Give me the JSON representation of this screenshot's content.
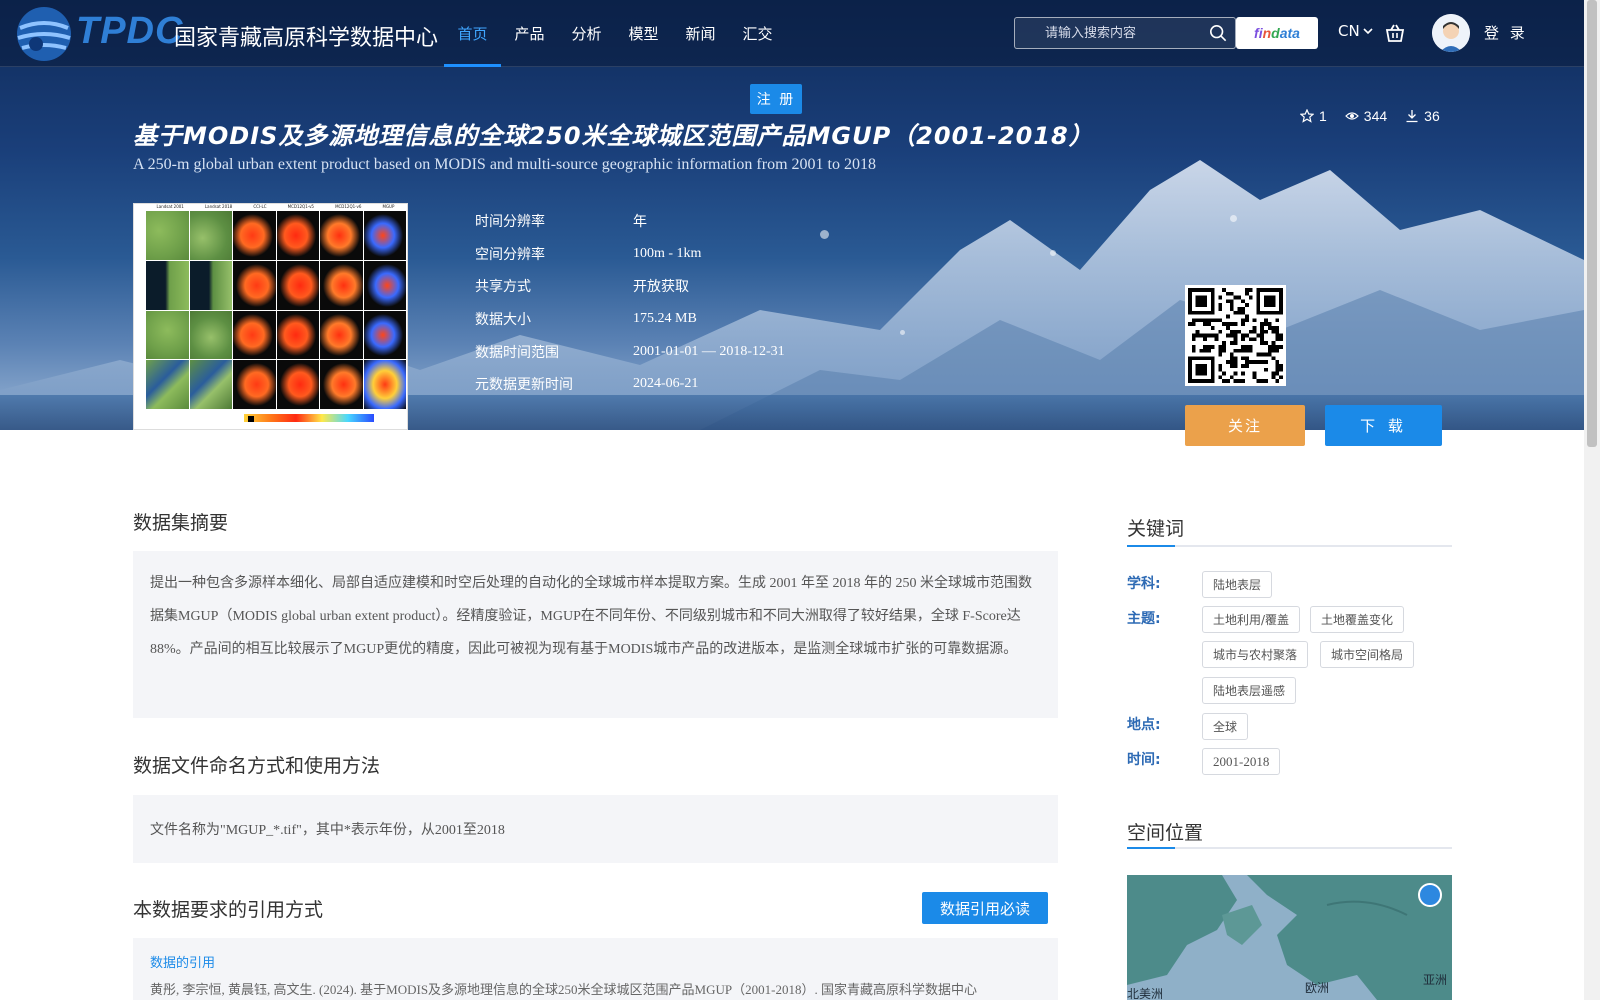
{
  "header": {
    "logo_letters": "TPDC",
    "logo_name": "国家青藏高原科学数据中心",
    "nav": [
      {
        "label": "首页",
        "active": true
      },
      {
        "label": "产品"
      },
      {
        "label": "分析"
      },
      {
        "label": "模型"
      },
      {
        "label": "新闻"
      },
      {
        "label": "汇交"
      }
    ],
    "search_placeholder": "请输入搜索内容",
    "findata": [
      "fi",
      "n",
      "d",
      "ata"
    ],
    "lang": "CN",
    "login": "登 录",
    "register": "注 册"
  },
  "dataset": {
    "title": "基于MODIS及多源地理信息的全球250米全球城区范围产品MGUP（2001-2018）",
    "subtitle": "A 250-m global urban extent product based on MODIS and multi-source geographic information from 2001 to 2018",
    "stats": {
      "stars": "1",
      "views": "344",
      "downloads": "36"
    },
    "meta": [
      {
        "k": "时间分辨率",
        "v": "年"
      },
      {
        "k": "空间分辨率",
        "v": "100m - 1km"
      },
      {
        "k": "共享方式",
        "v": "开放获取"
      },
      {
        "k": "数据大小",
        "v": "175.24 MB"
      },
      {
        "k": "数据时间范围",
        "v": "2001-01-01 — 2018-12-31"
      },
      {
        "k": "元数据更新时间",
        "v": "2024-06-21"
      }
    ],
    "thumbnail_headers": [
      "Landsat 2001",
      "Landsat 2018",
      "CCI-LC",
      "MCD12Q1-v5",
      "MCD12Q1-v6",
      "MGUP"
    ],
    "follow_label": "关注",
    "download_label": "下 载"
  },
  "main": {
    "abstract_title": "数据集摘要",
    "abstract_text": "提出一种包含多源样本细化、局部自适应建模和时空后处理的自动化的全球城市样本提取方案。生成 2001 年至 2018 年的 250 米全球城市范围数据集MGUP（MODIS global urban extent product）。经精度验证，MGUP在不同年份、不同级别城市和不同大洲取得了较好结果，全球 F-Score达88%。产品间的相互比较展示了MGUP更优的精度，因此可被视为现有基于MODIS城市产品的改进版本，是监测全球城市扩张的可靠数据源。",
    "naming_title": "数据文件命名方式和使用方法",
    "naming_text": "文件名称为\"MGUP_*.tif\"，其中*表示年份，从2001至2018",
    "citation_title": "本数据要求的引用方式",
    "citation_button": "数据引用必读",
    "citation_label": "数据的引用",
    "citation_text": "黄彤, 李宗恒, 黄晨钰, 高文生. (2024). 基于MODIS及多源地理信息的全球250米全球城区范围产品MGUP（2001-2018）. 国家青藏高原科学数据中心"
  },
  "sidebar": {
    "keywords_title": "关键词",
    "discipline_label": "学科:",
    "discipline_tags": [
      "陆地表层"
    ],
    "theme_label": "主题:",
    "theme_tags": [
      "土地利用/覆盖",
      "土地覆盖变化",
      "城市与农村聚落",
      "城市空间格局",
      "陆地表层遥感"
    ],
    "place_label": "地点:",
    "place_tags": [
      "全球"
    ],
    "time_label": "时间:",
    "time_tags": [
      "2001-2018"
    ],
    "location_title": "空间位置",
    "map_labels": {
      "europe": "欧洲",
      "asia": "亚洲",
      "america": "北美洲"
    }
  },
  "colors": {
    "accent": "#1b8ae8",
    "follow": "#eba14b",
    "keyword_label": "#2d6ab4",
    "hero_dark": "#0f2a59"
  }
}
